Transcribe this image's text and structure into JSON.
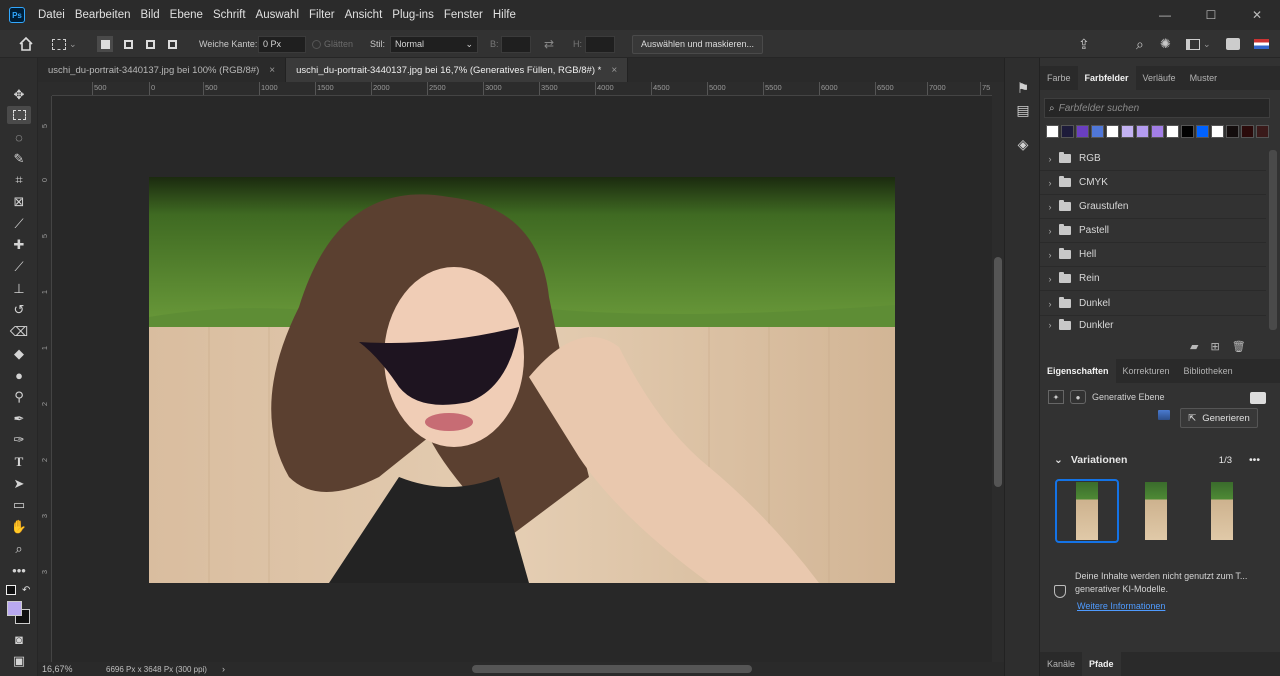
{
  "menu": [
    "Datei",
    "Bearbeiten",
    "Bild",
    "Ebene",
    "Schrift",
    "Auswahl",
    "Filter",
    "Ansicht",
    "Plug-ins",
    "Fenster",
    "Hilfe"
  ],
  "logo": "Ps",
  "options": {
    "feather_label": "Weiche Kante:",
    "feather_value": "0 Px",
    "smooth_label": "Glätten",
    "style_label": "Stil:",
    "style_value": "Normal",
    "w_label": "B:",
    "h_label": "H:",
    "select_mask_label": "Auswählen und maskieren..."
  },
  "tabs": [
    {
      "title": "uschi_du-portrait-3440137.jpg bei 100% (RGB/8#)",
      "close": "×"
    },
    {
      "title": "uschi_du-portrait-3440137.jpg bei 16,7% (Generatives Füllen, RGB/8#) *",
      "close": "×"
    }
  ],
  "ruler_h": [
    "500",
    "0",
    "500",
    "1000",
    "1500",
    "2000",
    "2500",
    "3000",
    "3500",
    "4000",
    "4500",
    "5000",
    "5500",
    "6000",
    "6500",
    "7000",
    "75"
  ],
  "ruler_v": [
    "5",
    "0",
    "5",
    "1",
    "1",
    "2",
    "2",
    "3",
    "3"
  ],
  "status": {
    "zoom": "16,67%",
    "doc_size": "6696 Px x 3648 Px (300 ppi)",
    "arrow": "›"
  },
  "swatches_panel": {
    "tabs": [
      "Farbe",
      "Farbfelder",
      "Verläufe",
      "Muster"
    ],
    "search_placeholder": "Farbfelder suchen",
    "swatch_colors": [
      "#ffffff",
      "#1d1b3a",
      "#6a3fc0",
      "#5077d8",
      "#ffffff",
      "#c3b2f2",
      "#b49cf0",
      "#a27ee6",
      "#ffffff",
      "#000000",
      "#0062ff",
      "#ffffff",
      "#130d0d",
      "#2a0a0a",
      "#3a1a1a"
    ],
    "folders": [
      "RGB",
      "CMYK",
      "Graustufen",
      "Pastell",
      "Hell",
      "Rein",
      "Dunkel",
      "Dunkler"
    ]
  },
  "props_panel": {
    "tabs": [
      "Eigenschaften",
      "Korrekturen",
      "Bibliotheken"
    ],
    "layer_type": "Generative Ebene",
    "generate_label": "Generieren",
    "variations_label": "Variationen",
    "variations_count": "1/3",
    "more": "•••",
    "notice": "Deine Inhalte werden nicht genutzt zum T... generativer KI-Modelle.",
    "link": "Weitere Informationen"
  },
  "bottom_tabs": [
    "Kanäle",
    "Pfade"
  ]
}
